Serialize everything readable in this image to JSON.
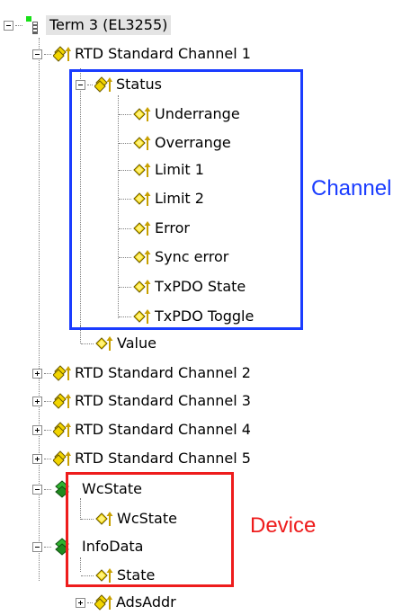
{
  "tree": {
    "root": {
      "label": "Term 3 (EL3255)",
      "icon": "terminal-icon"
    },
    "channel1": {
      "label": "RTD Standard Channel 1",
      "status": {
        "label": "Status",
        "items": [
          "Underrange",
          "Overrange",
          "Limit 1",
          "Limit 2",
          "Error",
          "Sync error",
          "TxPDO State",
          "TxPDO Toggle"
        ]
      },
      "value_label": "Value"
    },
    "channels": [
      "RTD Standard Channel 2",
      "RTD Standard Channel 3",
      "RTD Standard Channel 4",
      "RTD Standard Channel 5"
    ],
    "wcstate": {
      "label": "WcState",
      "child": "WcState"
    },
    "infodata": {
      "label": "InfoData",
      "child": "State"
    },
    "adsaddr": {
      "label": "AdsAddr"
    }
  },
  "annotations": {
    "channel": {
      "text": "Channel",
      "color": "#1a3cff"
    },
    "device": {
      "text": "Device",
      "color": "#ee1c1c"
    }
  },
  "colors": {
    "variable_icon": "#e8c400",
    "group_icon": "#1f8a1f",
    "arrow": "#c8a000"
  }
}
